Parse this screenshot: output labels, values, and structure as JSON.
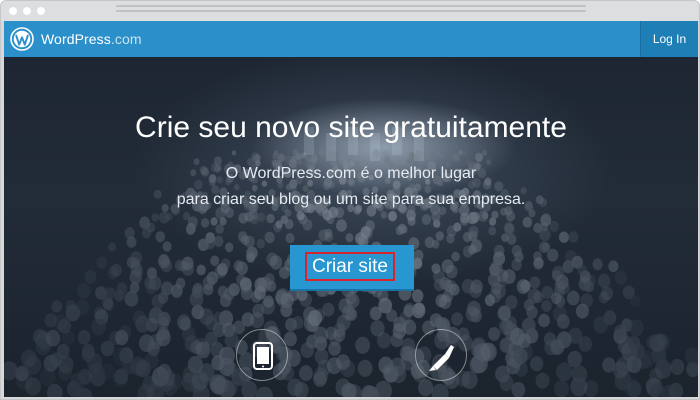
{
  "header": {
    "brand_name": "WordPress",
    "brand_suffix": ".com",
    "login_label": "Log In"
  },
  "hero": {
    "headline": "Crie seu novo site gratuitamente",
    "subtitle_line1": "O WordPress.com é o melhor lugar",
    "subtitle_line2": "para criar seu blog ou um site para sua empresa.",
    "cta_label": "Criar site"
  },
  "features": {
    "items": [
      {
        "icon": "tablet-icon"
      },
      {
        "icon": "paintbrush-icon"
      }
    ]
  },
  "colors": {
    "header_bg": "#2b90c9",
    "login_bg": "#1e7fb7",
    "cta_bg": "#2796d1",
    "highlight_border": "#d6252d"
  }
}
